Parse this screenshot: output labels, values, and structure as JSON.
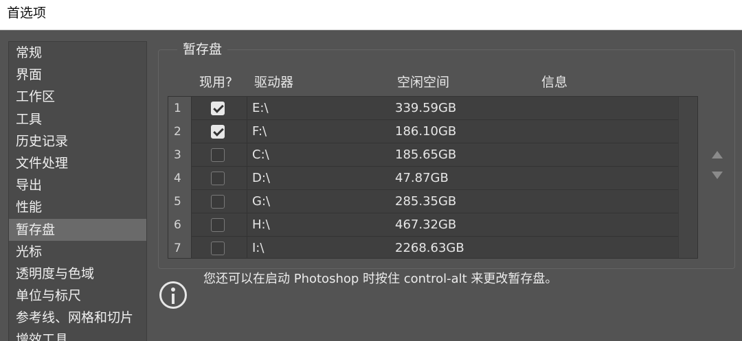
{
  "window": {
    "title": "首选项"
  },
  "sidebar": {
    "items": [
      {
        "label": "常规"
      },
      {
        "label": "界面"
      },
      {
        "label": "工作区"
      },
      {
        "label": "工具"
      },
      {
        "label": "历史记录"
      },
      {
        "label": "文件处理"
      },
      {
        "label": "导出"
      },
      {
        "label": "性能"
      },
      {
        "label": "暂存盘",
        "active": true
      },
      {
        "label": "光标"
      },
      {
        "label": "透明度与色域"
      },
      {
        "label": "单位与标尺"
      },
      {
        "label": "参考线、网格和切片"
      },
      {
        "label": "增效工具"
      }
    ]
  },
  "scratch": {
    "title": "暂存盘",
    "headers": {
      "active": "现用?",
      "drive": "驱动器",
      "free": "空闲空间",
      "info": "信息"
    },
    "rows": [
      {
        "num": "1",
        "checked": true,
        "drive": "E:\\",
        "free": "339.59GB"
      },
      {
        "num": "2",
        "checked": true,
        "drive": "F:\\",
        "free": "186.10GB"
      },
      {
        "num": "3",
        "checked": false,
        "drive": "C:\\",
        "free": "185.65GB"
      },
      {
        "num": "4",
        "checked": false,
        "drive": "D:\\",
        "free": "47.87GB"
      },
      {
        "num": "5",
        "checked": false,
        "drive": "G:\\",
        "free": "285.35GB"
      },
      {
        "num": "6",
        "checked": false,
        "drive": "H:\\",
        "free": "467.32GB"
      },
      {
        "num": "7",
        "checked": false,
        "drive": "I:\\",
        "free": "2268.63GB"
      }
    ],
    "info_text": "您还可以在启动 Photoshop 时按住 control-alt 来更改暂存盘。",
    "info_icon": "info-circle-icon",
    "move_up_icon": "triangle-up-icon",
    "move_down_icon": "triangle-down-icon"
  },
  "colors": {
    "panel_bg": "#535353",
    "active_item": "#6a6a6a",
    "table_bg": "#3f3f3f"
  }
}
